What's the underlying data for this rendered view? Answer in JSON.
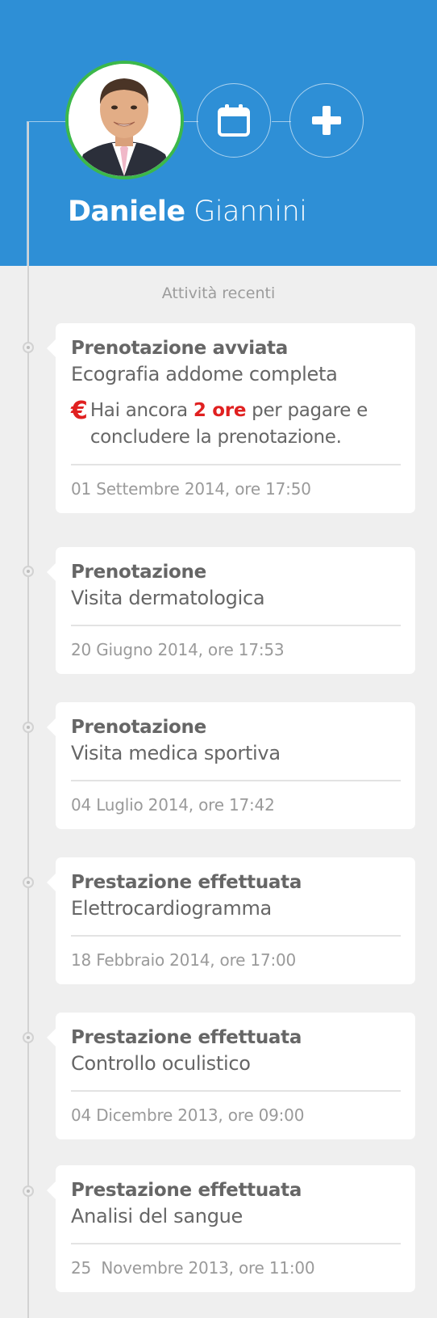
{
  "user": {
    "first_name": "Daniele",
    "last_name": "Giannini"
  },
  "header": {
    "icons": [
      "calendar-icon",
      "plus-icon"
    ]
  },
  "section_title": "Attività recenti",
  "notice": {
    "pre": "Hai ancora",
    "highlight": "2 ore",
    "post": "per pagare e concludere la prenotazione.",
    "symbol": "€"
  },
  "activities": [
    {
      "title": "Prenotazione avviata",
      "subtitle": "Ecografia addome completa",
      "date": "01 Settembre 2014, ore 17:50"
    },
    {
      "title": "Prenotazione",
      "subtitle": "Visita dermatologica",
      "date": "20 Giugno 2014, ore 17:53"
    },
    {
      "title": "Prenotazione",
      "subtitle": "Visita medica sportiva",
      "date": "04 Luglio 2014, ore 17:42"
    },
    {
      "title": "Prestazione effettuata",
      "subtitle": "Elettrocardiogramma",
      "date": "18 Febbraio 2014, ore 17:00"
    },
    {
      "title": "Prestazione effettuata",
      "subtitle": "Controllo oculistico",
      "date": "04 Dicembre 2013, ore 09:00"
    },
    {
      "title": "Prestazione effettuata",
      "subtitle": "Analisi del sangue",
      "date": "25  Novembre 2013, ore 11:00"
    }
  ],
  "colors": {
    "header": "#2e8fd6",
    "accent_green": "#3cb84a",
    "alert_red": "#e02020"
  }
}
